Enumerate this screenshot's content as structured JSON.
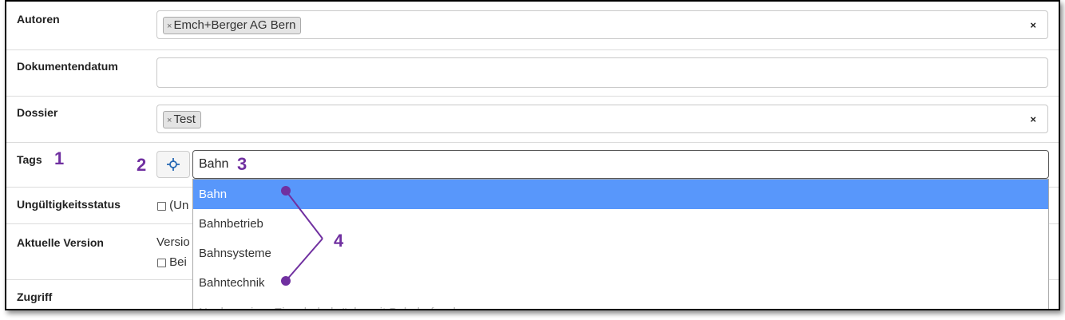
{
  "fields": {
    "autoren": {
      "label": "Autoren",
      "chip": "Emch+Berger AG Bern",
      "chip_remove": "×",
      "clear": "×"
    },
    "dokumentendatum": {
      "label": "Dokumentendatum",
      "value": ""
    },
    "dossier": {
      "label": "Dossier",
      "chip": "Test",
      "chip_remove": "×",
      "clear": "×"
    },
    "tags": {
      "label": "Tags",
      "input_value": "Bahn",
      "options": [
        "Bahn",
        "Bahnbetrieb",
        "Bahnsysteme",
        "Bahntechnik",
        "Neubau einer Eisenbahnbrücke mit Bahnhofsanlage"
      ],
      "highlighted_index": 0,
      "button_icon": "crosshair-icon"
    },
    "ungueltigkeitsstatus": {
      "label": "Ungültigkeitsstatus",
      "checkbox_text": "(Un"
    },
    "aktuelle_version": {
      "label": "Aktuelle Version",
      "text": "Versio",
      "checkbox_text": "Bei"
    },
    "zugriff": {
      "label": "Zugriff"
    }
  },
  "annotations": {
    "n1": "1",
    "n2": "2",
    "n3": "3",
    "n4": "4"
  },
  "colors": {
    "annotation": "#7030a0",
    "highlight": "#5897fb"
  }
}
